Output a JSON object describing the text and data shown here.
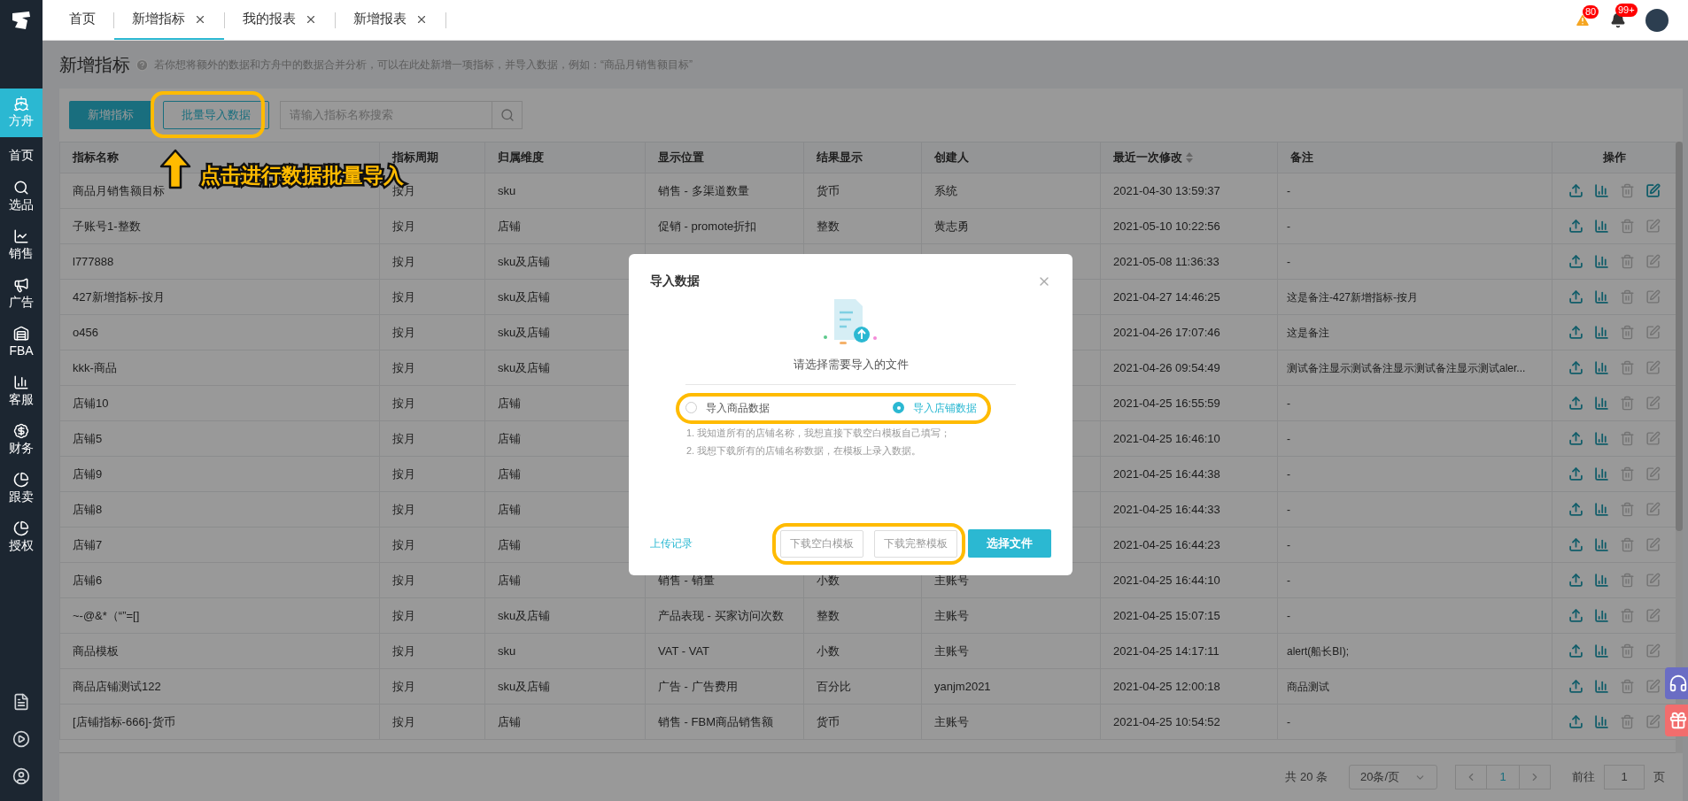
{
  "sidebar": {
    "items": [
      {
        "label": "方舟",
        "selected": true
      },
      {
        "label": "首页",
        "selected": false
      },
      {
        "label": "选品",
        "selected": false
      },
      {
        "label": "销售",
        "selected": false
      },
      {
        "label": "广告",
        "selected": false
      },
      {
        "label": "FBA",
        "selected": false
      },
      {
        "label": "客服",
        "selected": false
      },
      {
        "label": "财务",
        "selected": false
      },
      {
        "label": "跟卖",
        "selected": false
      },
      {
        "label": "授权",
        "selected": false
      }
    ]
  },
  "tabs": [
    {
      "label": "首页",
      "closable": false,
      "selected": false
    },
    {
      "label": "新增指标",
      "closable": true,
      "selected": true
    },
    {
      "label": "我的报表",
      "closable": true,
      "selected": false
    },
    {
      "label": "新增报表",
      "closable": true,
      "selected": false
    }
  ],
  "header_badges": {
    "alerts": "80",
    "notifications": "99+"
  },
  "page": {
    "title": "新增指标",
    "description": "若你想将额外的数据和方舟中的数据合并分析，可以在此处新增一项指标，并导入数据，例如：“商品月销售额目标”"
  },
  "toolbar": {
    "add_button": "新增指标",
    "import_button": "批量导入数据",
    "search_placeholder": "请输入指标名称搜索"
  },
  "annotation": {
    "text": "点击进行数据批量导入"
  },
  "table": {
    "columns": [
      "指标名称",
      "指标周期",
      "归属维度",
      "显示位置",
      "结果显示",
      "创建人",
      "最近一次修改",
      "备注",
      "操作"
    ],
    "rows": [
      {
        "name": "商品月销售额目标",
        "period": "按月",
        "dimension": "sku",
        "position": "销售 - 多渠道数量",
        "result": "货币",
        "creator": "系统",
        "modified": "2021-04-30 13:59:37",
        "remark": "-",
        "editable": true
      },
      {
        "name": "子账号1-整数",
        "period": "按月",
        "dimension": "店铺",
        "position": "促销 - promote折扣",
        "result": "整数",
        "creator": "黄志勇",
        "modified": "2021-05-10 10:22:56",
        "remark": "-",
        "editable": false
      },
      {
        "name": "l777888",
        "period": "按月",
        "dimension": "sku及店铺",
        "modified": "2021-05-08 11:36:33",
        "remark": "-",
        "editable": false
      },
      {
        "name": "427新增指标-按月",
        "period": "按月",
        "dimension": "sku及店铺",
        "modified": "2021-04-27 14:46:25",
        "remark": "这是备注-427新增指标-按月",
        "editable": false
      },
      {
        "name": "o456",
        "period": "按月",
        "dimension": "sku及店铺",
        "modified": "2021-04-26 17:07:46",
        "remark": "这是备注",
        "editable": false
      },
      {
        "name": "kkk-商品",
        "period": "按月",
        "dimension": "sku及店铺",
        "modified": "2021-04-26 09:54:49",
        "remark": "测试备注显示测试备注显示测试备注显示测试aler...",
        "editable": false
      },
      {
        "name": "店铺10",
        "period": "按月",
        "dimension": "店铺",
        "modified": "2021-04-25 16:55:59",
        "remark": "-",
        "editable": false
      },
      {
        "name": "店铺5",
        "period": "按月",
        "dimension": "店铺",
        "modified": "2021-04-25 16:46:10",
        "remark": "-",
        "editable": false
      },
      {
        "name": "店铺9",
        "period": "按月",
        "dimension": "店铺",
        "modified": "2021-04-25 16:44:38",
        "remark": "-",
        "editable": false
      },
      {
        "name": "店铺8",
        "period": "按月",
        "dimension": "店铺",
        "modified": "2021-04-25 16:44:33",
        "remark": "-",
        "editable": false
      },
      {
        "name": "店铺7",
        "period": "按月",
        "dimension": "店铺",
        "modified": "2021-04-25 16:44:23",
        "remark": "-",
        "editable": false
      },
      {
        "name": "店铺6",
        "period": "按月",
        "dimension": "店铺",
        "position": "销售 - 销量",
        "result": "小数",
        "creator": "主账号",
        "modified": "2021-04-25 16:44:10",
        "remark": "-",
        "editable": false
      },
      {
        "name": "~-@&*（“”=[]",
        "period": "按月",
        "dimension": "sku及店铺",
        "position": "产品表现 - 买家访问次数",
        "result": "整数",
        "creator": "主账号",
        "modified": "2021-04-25 15:07:15",
        "remark": "-",
        "editable": false
      },
      {
        "name": "商品模板",
        "period": "按月",
        "dimension": "sku",
        "position": "VAT - VAT",
        "result": "小数",
        "creator": "主账号",
        "modified": "2021-04-25 14:17:11",
        "remark": "alert(船长BI);",
        "editable": false
      },
      {
        "name": "商品店铺测试122",
        "period": "按月",
        "dimension": "sku及店铺",
        "position": "广告 - 广告费用",
        "result": "百分比",
        "creator": "yanjm2021",
        "modified": "2021-04-25 12:00:18",
        "remark": "商品测试",
        "editable": false
      },
      {
        "name": "[店铺指标-666]-货币",
        "period": "按月",
        "dimension": "店铺",
        "position": "销售 - FBM商品销售额",
        "result": "货币",
        "creator": "主账号",
        "modified": "2021-04-25 10:54:52",
        "remark": "-",
        "editable": false
      }
    ]
  },
  "pagination": {
    "total": "共 20 条",
    "page_size": "20条/页",
    "current": "1",
    "goto_label": "前往",
    "goto_value": "1",
    "page_suffix": "页"
  },
  "dialog": {
    "title": "导入数据",
    "prompt": "请选择需要导入的文件",
    "options": [
      {
        "label": "导入商品数据",
        "selected": false
      },
      {
        "label": "导入店铺数据",
        "selected": true
      }
    ],
    "hints": [
      "1. 我知道所有的店铺名称，我想直接下载空白模板自己填写；",
      "2. 我想下载所有的店铺名称数据，在模板上录入数据。"
    ],
    "history_link": "上传记录",
    "buttons": [
      "下载空白模板",
      "下载完整模板"
    ],
    "primary_button": "选择文件"
  }
}
